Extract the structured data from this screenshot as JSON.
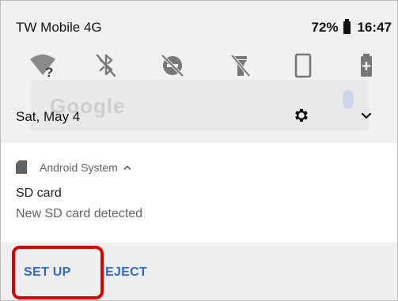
{
  "status_bar": {
    "carrier": "TW Mobile 4G",
    "battery": "72%",
    "time": "16:47"
  },
  "quick_settings": {
    "tiles": [
      "wifi-icon",
      "bluetooth-off-icon",
      "do-not-disturb-off-icon",
      "flashlight-off-icon",
      "rotation-icon",
      "battery-saver-icon"
    ],
    "date": "Sat, May 4"
  },
  "background_widget": {
    "logo_text": "Google"
  },
  "notification": {
    "app_name": "Android System",
    "title": "SD card",
    "text": "New SD card detected",
    "actions": {
      "setup": "SET UP",
      "eject": "EJECT"
    }
  },
  "colors": {
    "accent": "#3367d6",
    "highlight": "#e00000",
    "shade_bg": "#f1f1f1"
  }
}
